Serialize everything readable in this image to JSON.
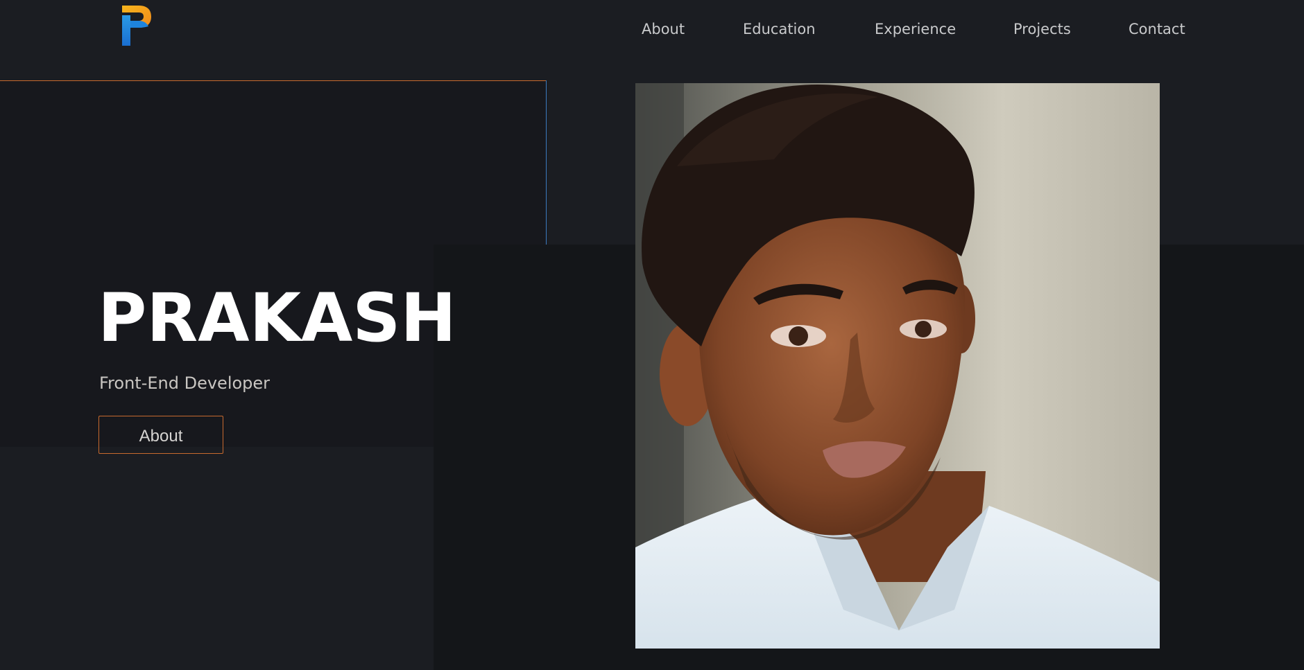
{
  "header": {
    "logo_icon": "p-letter-logo-icon",
    "nav": [
      {
        "label": "About"
      },
      {
        "label": "Education"
      },
      {
        "label": "Experience"
      },
      {
        "label": "Projects"
      },
      {
        "label": "Contact"
      }
    ]
  },
  "hero": {
    "name": "PRAKASH",
    "role": "Front-End Developer",
    "button_label": "About"
  },
  "colors": {
    "background": "#1b1d22",
    "accent_orange": "#c86a2e",
    "accent_blue": "#3b7bc0",
    "text_primary": "#ffffff",
    "text_secondary": "#c9cacc"
  }
}
